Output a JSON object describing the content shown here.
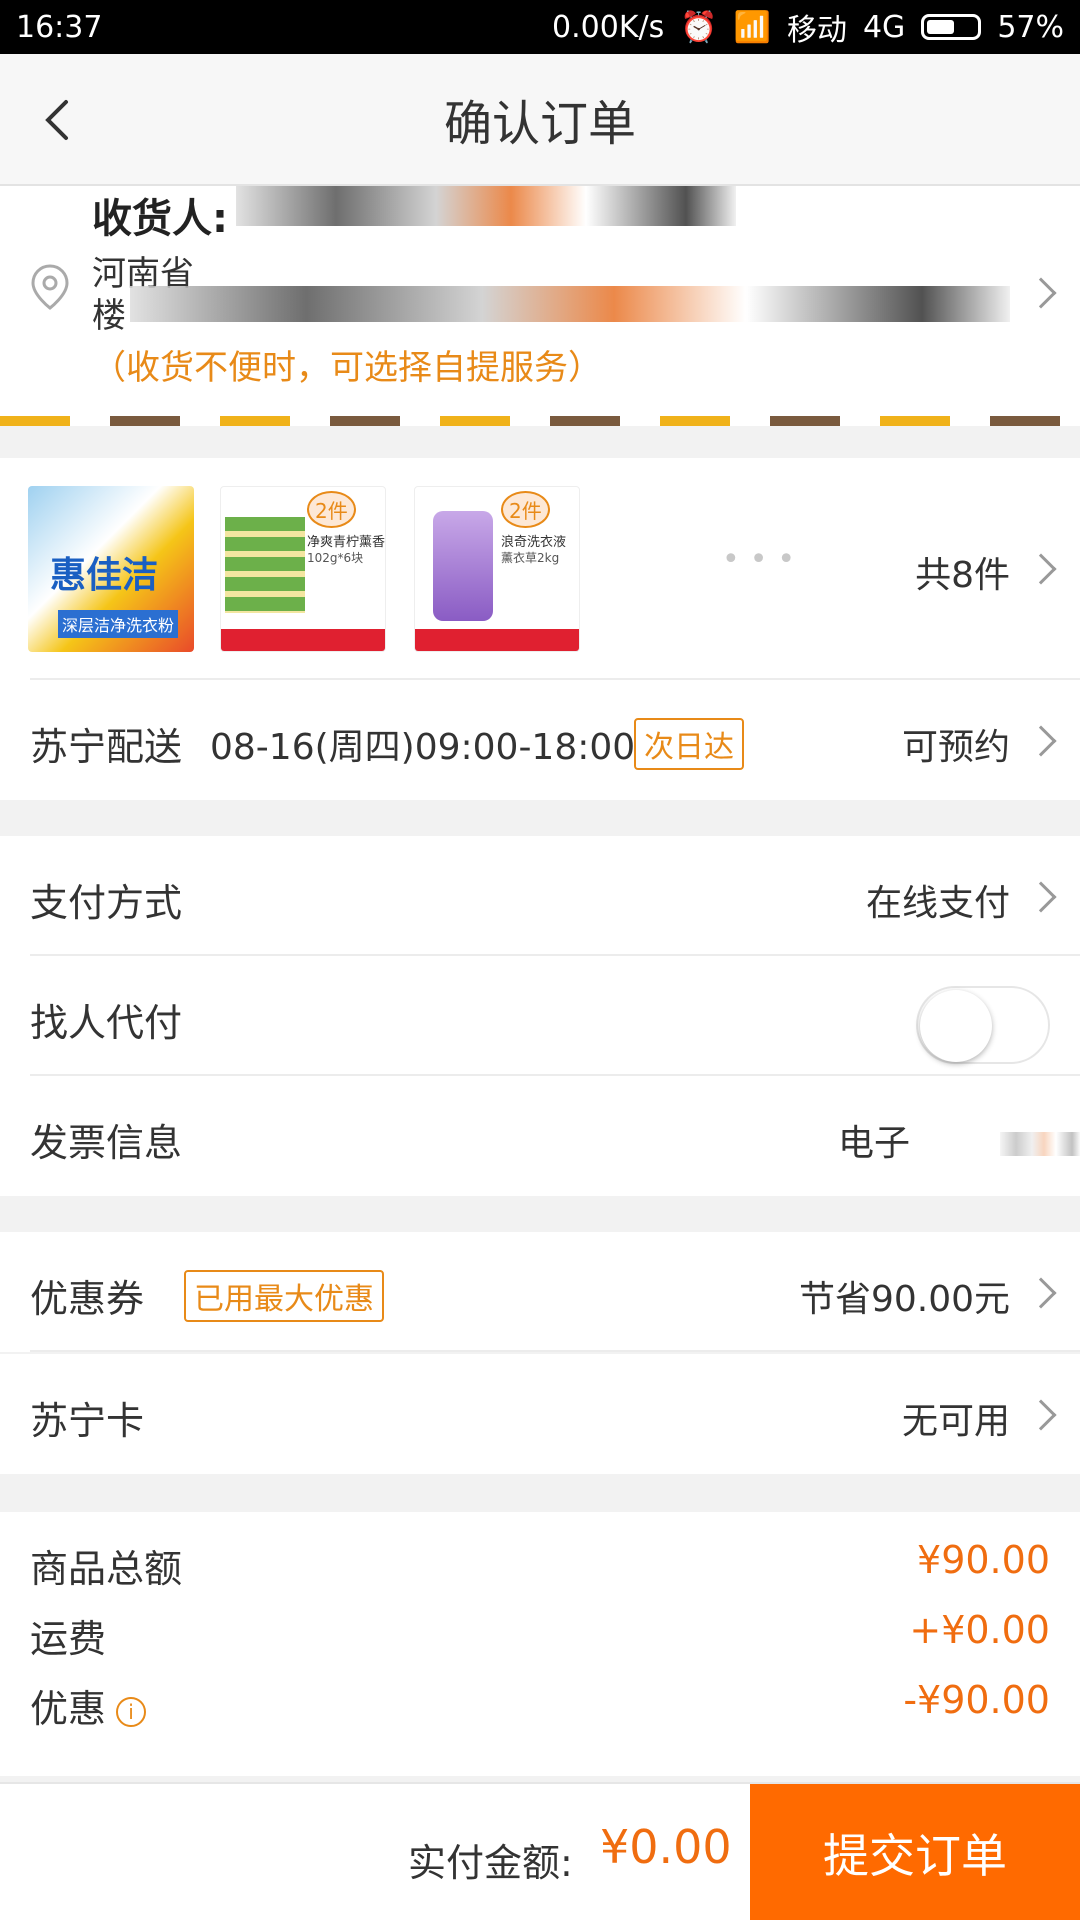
{
  "status_bar": {
    "time": "16:37",
    "speed": "0.00K/s",
    "carrier": "移动",
    "network": "4G",
    "battery": "57%",
    "battery_level": 0.57
  },
  "nav": {
    "title": "确认订单"
  },
  "address": {
    "name_label": "收货人:",
    "line1": "河南省",
    "line2": "楼",
    "hint": "（收货不便时，可选择自提服务）"
  },
  "products": {
    "count_text": "共8件",
    "items": [
      {
        "title": "惠佳洁",
        "sub": "深层洁净洗衣粉",
        "badge": ""
      },
      {
        "title": "净爽青柠薰香",
        "sub": "102g*6块",
        "badge": "2件"
      },
      {
        "title": "浪奇洗衣液",
        "sub": "薰衣草2kg",
        "badge": "2件"
      }
    ]
  },
  "delivery": {
    "label": "苏宁配送",
    "time": "08-16(周四)09:00-18:00",
    "tag": "次日达",
    "value": "可预约"
  },
  "payment": {
    "label": "支付方式",
    "value": "在线支付"
  },
  "proxy_pay": {
    "label": "找人代付",
    "enabled": false
  },
  "invoice": {
    "label": "发票信息",
    "value": "电子"
  },
  "coupon": {
    "label": "优惠券",
    "tag": "已用最大优惠",
    "value": "节省90.00元"
  },
  "card": {
    "label": "苏宁卡",
    "value": "无可用"
  },
  "summary": {
    "goods_label": "商品总额",
    "goods_value": "¥90.00",
    "shipping_label": "运费",
    "shipping_value": "+¥0.00",
    "discount_label": "优惠",
    "discount_value": "-¥90.00"
  },
  "footer": {
    "pay_label": "实付金额:",
    "pay_value": "¥0.00",
    "submit": "提交订单"
  },
  "colors": {
    "accent": "#ff6a00",
    "price": "#f06d10",
    "tag": "#e88a18"
  }
}
